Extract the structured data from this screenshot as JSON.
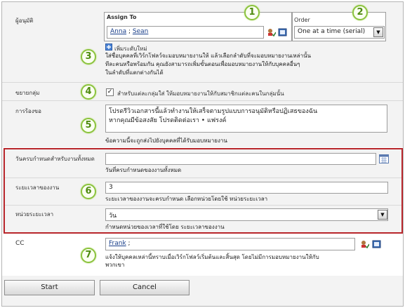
{
  "fields": {
    "approvers": {
      "label": "ผู้อนุมัติ",
      "assign_to_header": "Assign To",
      "assignees": [
        "Anna",
        "Sean"
      ],
      "separator": ";",
      "order_header": "Order",
      "order_value": "One at a time (serial)",
      "add_stage": "เพิ่มระดับใหม่",
      "help": [
        "ใส่ชื่อบุคคลที่เวิร์กโฟลว์จะมอบหมายงานให้ แล้วเลือกลำดับที่จะมอบหมายงานเหล่านั้น",
        "ทีละคนหรือพร้อมกัน คุณยังสามารถเพิ่มขั้นตอนเพื่อมอบหมายงานให้กับบุคคลอื่นๆ",
        "ในลำดับที่แตกต่างกันได้"
      ]
    },
    "expand_groups": {
      "label": "ขยายกลุ่ม",
      "checkbox_label": "สำหรับแต่ละกลุ่มใส่ ให้มอบหมายงานให้กับสมาชิกแต่ละคนในกลุ่มนั้น",
      "checked": true
    },
    "request": {
      "label": "การร้องขอ",
      "text_line1": "โปรดรีวิวเอกสารนี้แล้วทำงานให้เสร็จตามรูปแบบการอนุมัติหรือปฏิเสธของฉัน",
      "text_line2": "หากคุณมีข้อสงสัย โปรดติดต่อเรา • แฟรงค์",
      "help": "ข้อความนี้จะถูกส่งไปยังบุคคลที่ได้รับมอบหมายงาน"
    },
    "due_date": {
      "label": "วันครบกำหนดสำหรับงานทั้งหมด",
      "value": "",
      "help": "วันที่ครบกำหนดของงานทั้งหมด"
    },
    "duration": {
      "label": "ระยะเวลาของงาน",
      "value": "3",
      "help": "ระยะเวลาของงานจะครบกำหนด เลือกหน่วยโดยใช้ หน่วยระยะเวลา"
    },
    "duration_units": {
      "label": "หน่วยระยะเวลา",
      "value": "วัน",
      "help": "กำหนดหน่วยของเวลาที่ใช้โดย ระยะเวลาของงาน"
    },
    "cc": {
      "label": "CC",
      "value": "Frank",
      "separator": ";",
      "help_line1": "แจ้งให้บุคคลเหล่านี้ทราบเมื่อเวิร์กโฟลว์เริ่มต้นและสิ้นสุด โดยไม่มีการมอบหมายงานให้กับ",
      "help_line2": "พวกเขา"
    }
  },
  "buttons": {
    "start": "Start",
    "cancel": "Cancel"
  },
  "callouts": [
    "1",
    "2",
    "3",
    "4",
    "5",
    "6",
    "7"
  ],
  "colors": {
    "callout_border": "#8cc33f",
    "highlight_box": "#b8262b",
    "link": "#1a3f8a"
  },
  "icons": [
    "check-names-icon",
    "browse-address-book-icon",
    "add-stage-icon",
    "calendar-icon",
    "dropdown-arrow-icon"
  ]
}
